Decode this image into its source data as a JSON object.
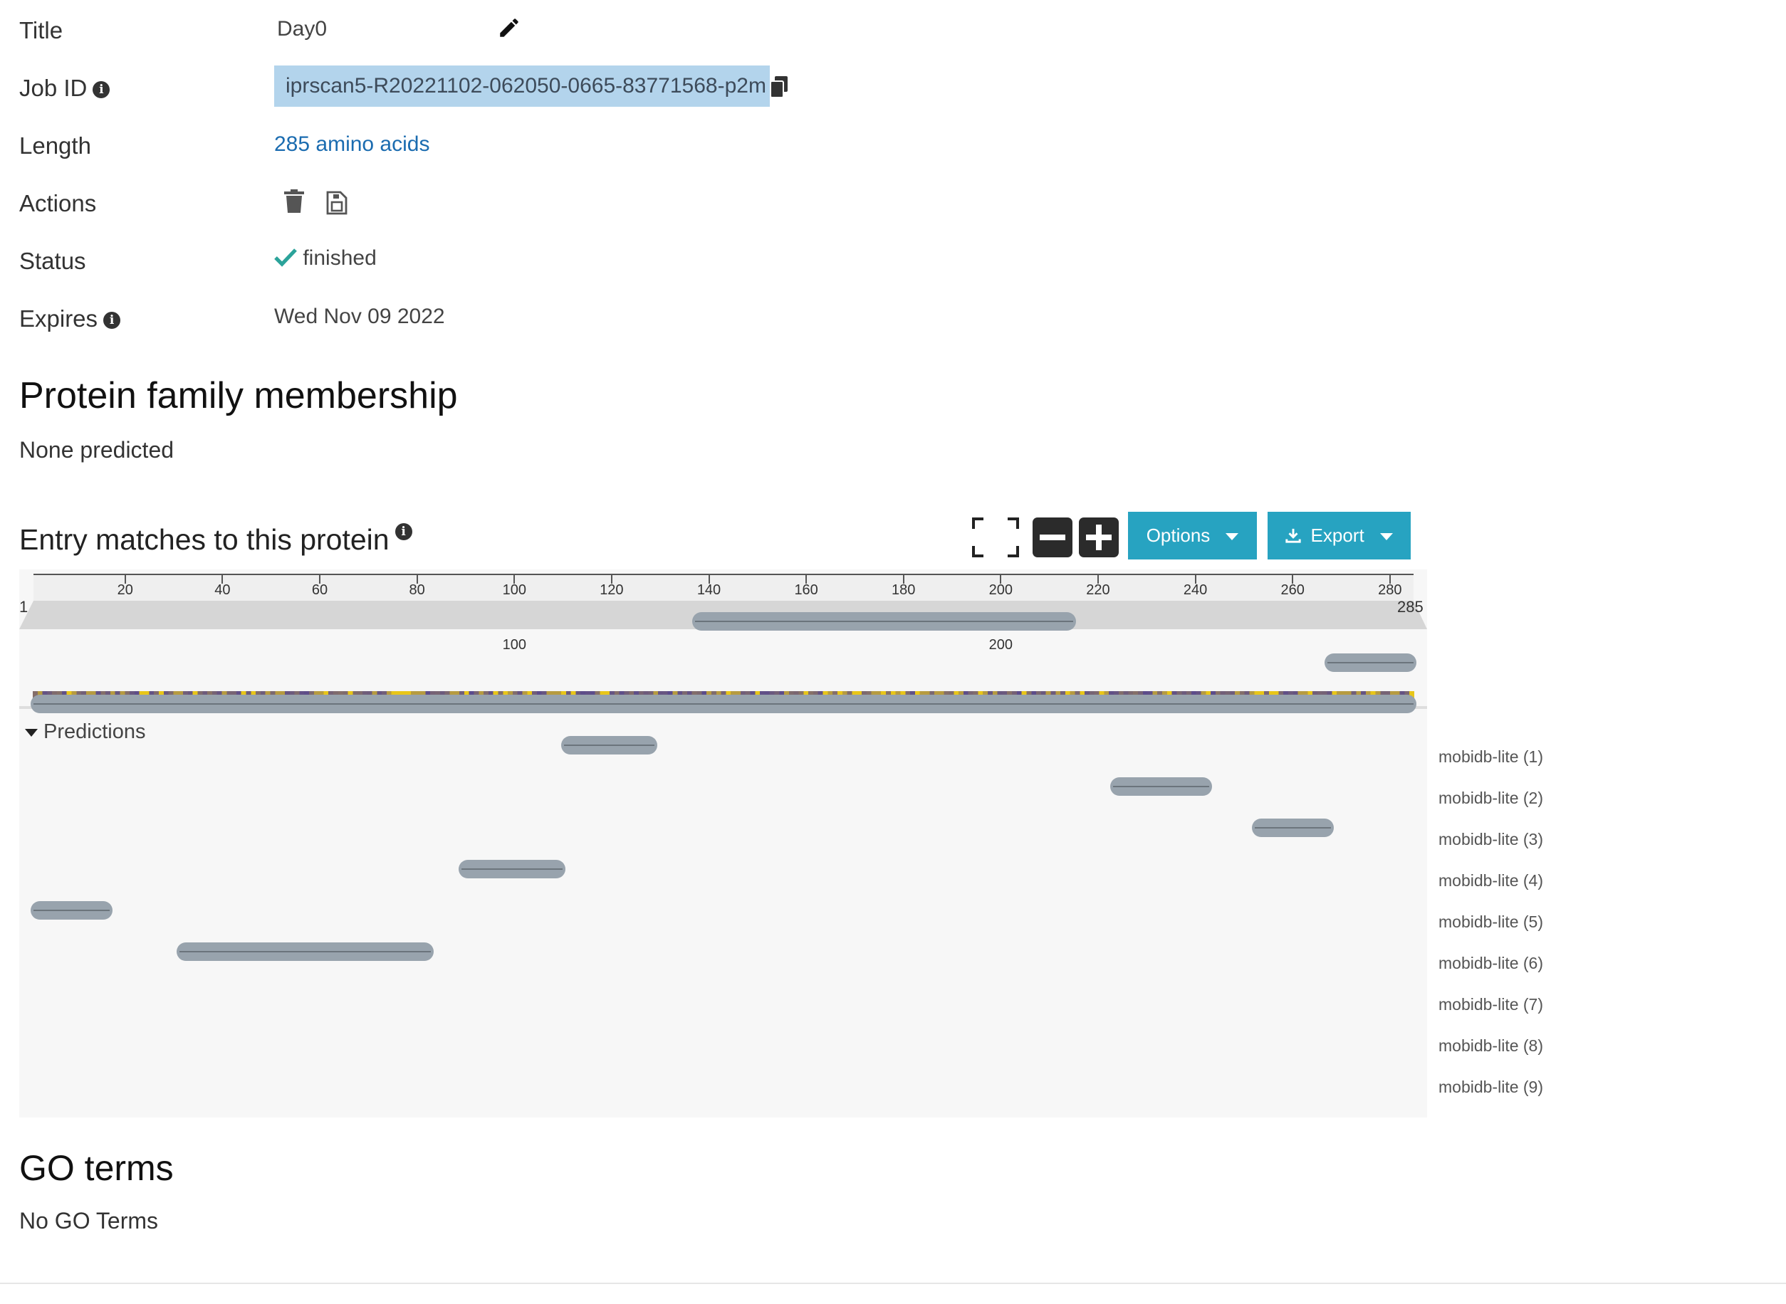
{
  "info": {
    "title_label": "Title",
    "title_value": "Day0",
    "jobid_label": "Job ID",
    "jobid_value": "iprscan5-R20221102-062050-0665-83771568-p2m",
    "length_label": "Length",
    "length_value": "285 amino acids",
    "actions_label": "Actions",
    "status_label": "Status",
    "status_value": "finished",
    "expires_label": "Expires",
    "expires_value": "Wed Nov 09 2022"
  },
  "icons": {
    "edit": "pencil-icon",
    "info": "info-icon",
    "copy": "copy-icon",
    "delete": "trash-icon",
    "save": "save-file-icon",
    "status": "check-icon",
    "fullscreen": "fullscreen-icon",
    "zoom_out": "minus-icon",
    "zoom_in": "plus-icon",
    "export": "download-icon"
  },
  "family": {
    "heading": "Protein family membership",
    "text": "None predicted"
  },
  "matches": {
    "heading": "Entry matches to this protein",
    "options_label": "Options",
    "export_label": "Export",
    "ruler_start": "1",
    "ruler_end": "285",
    "minor_ticks": [
      "20",
      "40",
      "60",
      "80",
      "100",
      "120",
      "140",
      "160",
      "180",
      "200",
      "220",
      "240",
      "260",
      "280"
    ],
    "major_ticks": [
      "100",
      "200"
    ],
    "section_label": "Predictions",
    "sequence_length": 285,
    "tracks": [
      {
        "label": "mobidb-lite (1)",
        "start": 137,
        "end": 215
      },
      {
        "label": "mobidb-lite (2)",
        "start": 267,
        "end": 285
      },
      {
        "label": "mobidb-lite (3)",
        "start": 1,
        "end": 285
      },
      {
        "label": "mobidb-lite (4)",
        "start": 110,
        "end": 129
      },
      {
        "label": "mobidb-lite (5)",
        "start": 223,
        "end": 243
      },
      {
        "label": "mobidb-lite (6)",
        "start": 252,
        "end": 268
      },
      {
        "label": "mobidb-lite (7)",
        "start": 89,
        "end": 110
      },
      {
        "label": "mobidb-lite (8)",
        "start": 1,
        "end": 17
      },
      {
        "label": "mobidb-lite (9)",
        "start": 31,
        "end": 83
      }
    ],
    "colors": {
      "track": "#98a3ad",
      "low": "#5a4a8c",
      "high": "#e8c619",
      "accent": "#27a3c1"
    }
  },
  "go": {
    "heading": "GO terms",
    "text": "No GO Terms"
  }
}
